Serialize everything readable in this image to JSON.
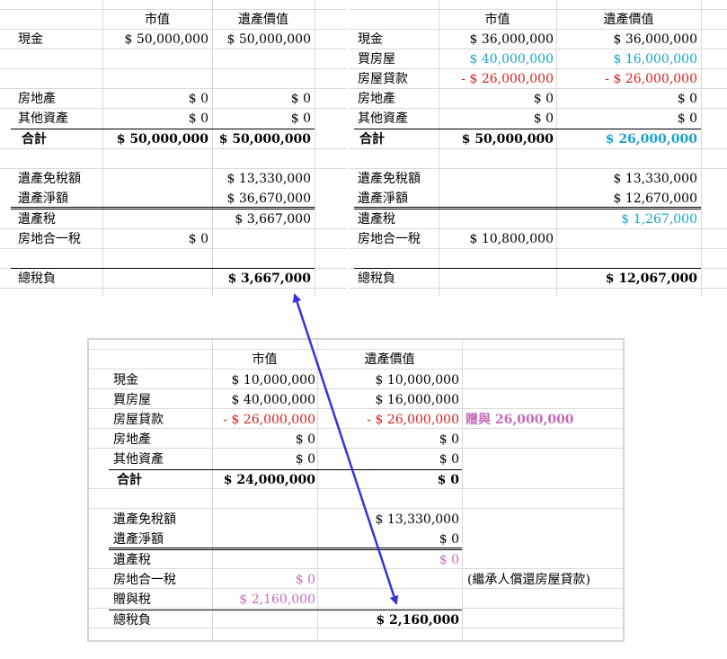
{
  "headers": {
    "market": "市值",
    "estate": "遺產價值"
  },
  "left": {
    "rows": [
      {
        "label": "現金",
        "market": "$ 50,000,000",
        "estate": "$ 50,000,000"
      },
      {
        "label": "房地產",
        "market": "$ 0",
        "estate": "$ 0"
      },
      {
        "label": "其他資產",
        "market": "$ 0",
        "estate": "$ 0"
      },
      {
        "label": "合計",
        "market": "$ 50,000,000",
        "estate": "$ 50,000,000"
      },
      {
        "label": "遺產免稅額",
        "estate": "$ 13,330,000"
      },
      {
        "label": "遺產淨額",
        "estate": "$ 36,670,000"
      },
      {
        "label": "遺產稅",
        "estate": "$ 3,667,000"
      },
      {
        "label": "房地合一稅",
        "market": "$ 0"
      },
      {
        "label": "總稅負",
        "estate": "$ 3,667,000"
      }
    ]
  },
  "right": {
    "rows": [
      {
        "label": "現金",
        "market": "$ 36,000,000",
        "estate": "$ 36,000,000"
      },
      {
        "label": "買房屋",
        "market": "$ 40,000,000",
        "estate": "$ 16,000,000"
      },
      {
        "label": "房屋貸款",
        "market": "- $ 26,000,000",
        "estate": "- $ 26,000,000"
      },
      {
        "label": "房地產",
        "market": "$ 0",
        "estate": "$ 0"
      },
      {
        "label": "其他資產",
        "market": "$ 0",
        "estate": "$ 0"
      },
      {
        "label": "合計",
        "market": "$ 50,000,000",
        "estate": "$ 26,000,000"
      },
      {
        "label": "遺產免稅額",
        "estate": "$ 13,330,000"
      },
      {
        "label": "遺產淨額",
        "estate": "$ 12,670,000"
      },
      {
        "label": "遺產稅",
        "estate": "$ 1,267,000"
      },
      {
        "label": "房地合一稅",
        "market": "$ 10,800,000"
      },
      {
        "label": "總稅負",
        "estate": "$ 12,067,000"
      }
    ]
  },
  "bottom": {
    "rows": [
      {
        "label": "現金",
        "market": "$ 10,000,000",
        "estate": "$ 10,000,000"
      },
      {
        "label": "買房屋",
        "market": "$ 40,000,000",
        "estate": "$ 16,000,000"
      },
      {
        "label": "房屋貸款",
        "market": "- $ 26,000,000",
        "estate": "- $ 26,000,000",
        "note": "贈與 26,000,000"
      },
      {
        "label": "房地產",
        "market": "$ 0",
        "estate": "$ 0"
      },
      {
        "label": "其他資產",
        "market": "$ 0",
        "estate": "$ 0"
      },
      {
        "label": "合計",
        "market": "$ 24,000,000",
        "estate": "$ 0"
      },
      {
        "label": "遺產免稅額",
        "estate": "$ 13,330,000"
      },
      {
        "label": "遺產淨額",
        "estate": "$ 0"
      },
      {
        "label": "遺產稅",
        "estate": "$ 0"
      },
      {
        "label": "房地合一稅",
        "market": "$ 0",
        "note": "(繼承人償還房屋貸款)"
      },
      {
        "label": "贈與稅",
        "market": "$ 2,160,000"
      },
      {
        "label": "總稅負",
        "estate": "$ 2,160,000"
      }
    ]
  },
  "colors": {
    "blue": "#1aa3c9",
    "red": "#d42020",
    "pink": "#c46bb8",
    "arrow": "#3333dd"
  }
}
